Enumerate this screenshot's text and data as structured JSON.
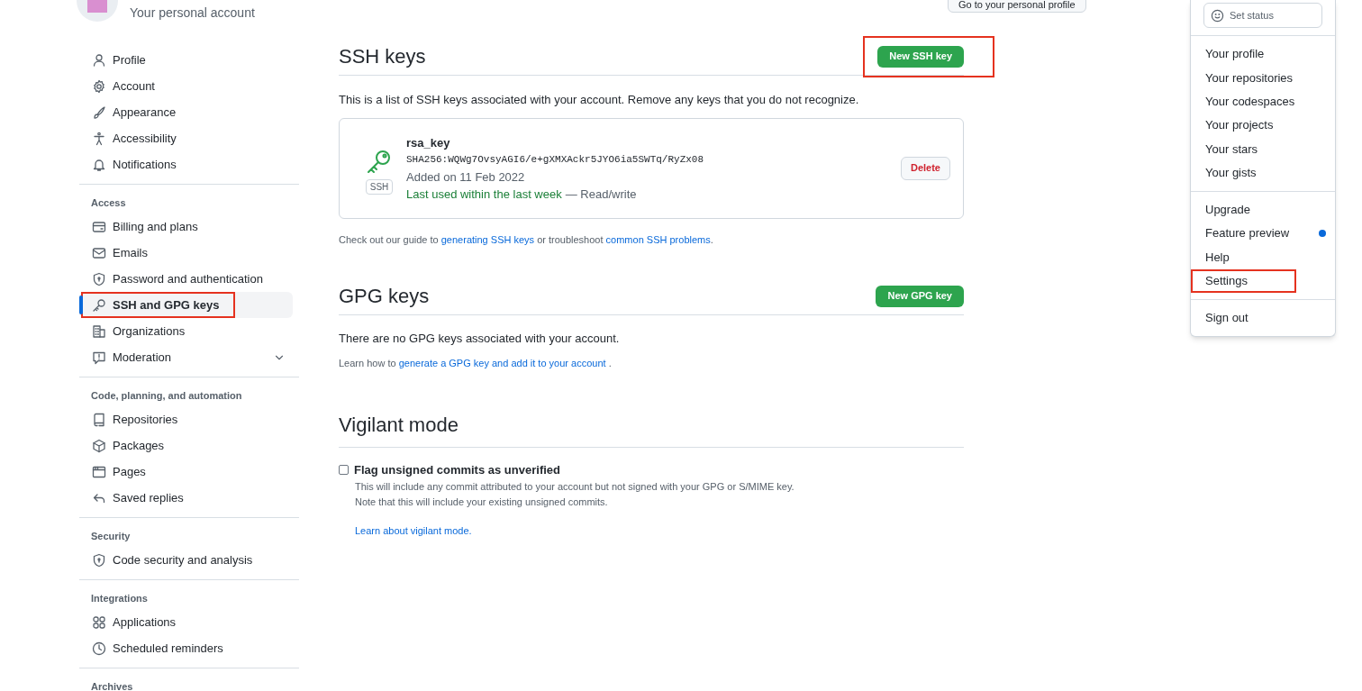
{
  "account": {
    "subtitle": "Your personal account",
    "profile_button": "Go to your personal profile"
  },
  "sidebar": {
    "sections": [
      {
        "items": [
          {
            "label": "Profile",
            "kind": "link",
            "selected": false,
            "annotated": false
          },
          {
            "label": "Account",
            "kind": "link",
            "selected": false,
            "annotated": false
          },
          {
            "label": "Appearance",
            "kind": "link",
            "selected": false,
            "annotated": false
          },
          {
            "label": "Accessibility",
            "kind": "link",
            "selected": false,
            "annotated": false
          },
          {
            "label": "Notifications",
            "kind": "link",
            "selected": false,
            "annotated": false
          }
        ]
      },
      {
        "heading": "Access",
        "items": [
          {
            "label": "Billing and plans",
            "kind": "link",
            "selected": false,
            "annotated": false
          },
          {
            "label": "Emails",
            "kind": "link",
            "selected": false,
            "annotated": false
          },
          {
            "label": "Password and authentication",
            "kind": "link",
            "selected": false,
            "annotated": false
          },
          {
            "label": "SSH and GPG keys",
            "kind": "link",
            "selected": true,
            "annotated": true
          },
          {
            "label": "Organizations",
            "kind": "link",
            "selected": false,
            "annotated": false
          },
          {
            "label": "Moderation",
            "kind": "collapsible",
            "selected": false,
            "annotated": false
          }
        ]
      },
      {
        "heading": "Code, planning, and automation",
        "items": [
          {
            "label": "Repositories",
            "kind": "link",
            "selected": false,
            "annotated": false
          },
          {
            "label": "Packages",
            "kind": "link",
            "selected": false,
            "annotated": false
          },
          {
            "label": "Pages",
            "kind": "link",
            "selected": false,
            "annotated": false
          },
          {
            "label": "Saved replies",
            "kind": "link",
            "selected": false,
            "annotated": false
          }
        ]
      },
      {
        "heading": "Security",
        "items": [
          {
            "label": "Code security and analysis",
            "kind": "link",
            "selected": false,
            "annotated": false
          }
        ]
      },
      {
        "heading": "Integrations",
        "items": [
          {
            "label": "Applications",
            "kind": "link",
            "selected": false,
            "annotated": false
          },
          {
            "label": "Scheduled reminders",
            "kind": "link",
            "selected": false,
            "annotated": false
          }
        ]
      },
      {
        "heading": "Archives"
      }
    ]
  },
  "ssh": {
    "title": "SSH keys",
    "button": {
      "label": "New SSH key",
      "annotated": true
    },
    "intro": "This is a list of SSH keys associated with your account. Remove any keys that you do not recognize.",
    "keys": [
      {
        "name": "rsa_key",
        "fingerprint": "SHA256:WQWg7OvsyAGI6/e+gXMXAckr5JYO6ia5SWTq/RyZx08",
        "badge": "SSH",
        "added": "Added on 11 Feb 2022",
        "last_used": "Last used within the last week",
        "access": "— Read/write",
        "action": "Delete"
      }
    ],
    "guide": [
      {
        "text": "Check out our guide to ",
        "link": false
      },
      {
        "text": "generating SSH keys",
        "link": true
      },
      {
        "text": " or troubleshoot ",
        "link": false
      },
      {
        "text": "common SSH problems",
        "link": true
      },
      {
        "text": ".",
        "link": false
      }
    ]
  },
  "gpg": {
    "title": "GPG keys",
    "button": {
      "label": "New GPG key",
      "annotated": false
    },
    "empty": "There are no GPG keys associated with your account.",
    "learn": [
      {
        "text": "Learn how to ",
        "link": false
      },
      {
        "text": "generate a GPG key and add it to your account",
        "link": true
      },
      {
        "text": " .",
        "link": false
      }
    ]
  },
  "vigilant": {
    "title": "Vigilant mode",
    "checkbox": {
      "label": "Flag unsigned commits as unverified",
      "checked": false
    },
    "notes": [
      "This will include any commit attributed to your account but not signed with your GPG or S/MIME key.",
      "Note that this will include your existing unsigned commits."
    ],
    "link": "Learn about vigilant mode."
  },
  "menu": {
    "set_status": "Set status",
    "groups": [
      [
        {
          "label": "Your profile",
          "unread": false,
          "annotated": false
        },
        {
          "label": "Your repositories",
          "unread": false,
          "annotated": false
        },
        {
          "label": "Your codespaces",
          "unread": false,
          "annotated": false
        },
        {
          "label": "Your projects",
          "unread": false,
          "annotated": false
        },
        {
          "label": "Your stars",
          "unread": false,
          "annotated": false
        },
        {
          "label": "Your gists",
          "unread": false,
          "annotated": false
        }
      ],
      [
        {
          "label": "Upgrade",
          "unread": false,
          "annotated": false
        },
        {
          "label": "Feature preview",
          "unread": true,
          "annotated": false
        },
        {
          "label": "Help",
          "unread": false,
          "annotated": false
        },
        {
          "label": "Settings",
          "unread": false,
          "annotated": true
        }
      ],
      [
        {
          "label": "Sign out",
          "unread": false,
          "annotated": false
        }
      ]
    ]
  }
}
